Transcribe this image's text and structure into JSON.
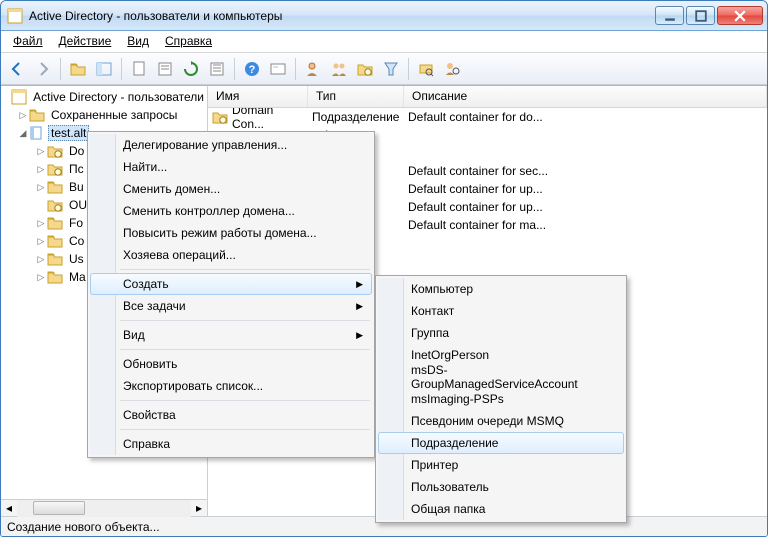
{
  "titlebar": {
    "title": "Active Directory - пользователи и компьютеры"
  },
  "menubar": {
    "file": "Файл",
    "action": "Действие",
    "view": "Вид",
    "help": "Справка"
  },
  "tree": {
    "root": "Active Directory - пользователи",
    "saved": "Сохраненные запросы",
    "domain": "test.alt",
    "children": [
      "Do",
      "Пс",
      "Bu",
      "OU",
      "Fo",
      "Co",
      "Us",
      "Ma"
    ]
  },
  "columns": {
    "name": "Имя",
    "type": "Тип",
    "desc": "Описание"
  },
  "rows": [
    {
      "name": "Domain Con...",
      "type": "Подразделение",
      "desc": "Default container for do..."
    },
    {
      "name": "",
      "type": "nain",
      "desc": ""
    },
    {
      "name": "",
      "type": "ение",
      "desc": ""
    },
    {
      "name": "",
      "type": "",
      "desc": "Default container for sec..."
    },
    {
      "name": "",
      "type": "",
      "desc": "Default container for up..."
    },
    {
      "name": "",
      "type": "",
      "desc": "Default container for up..."
    },
    {
      "name": "",
      "type": "",
      "desc": "Default container for ma..."
    }
  ],
  "ctx1": {
    "delegate": "Делегирование управления...",
    "find": "Найти...",
    "change_domain": "Сменить домен...",
    "change_dc": "Сменить контроллер домена...",
    "raise": "Повысить режим работы домена...",
    "masters": "Хозяева операций...",
    "create": "Создать",
    "all_tasks": "Все задачи",
    "view": "Вид",
    "refresh": "Обновить",
    "export": "Экспортировать список...",
    "properties": "Свойства",
    "help": "Справка"
  },
  "ctx2": {
    "items": [
      "Компьютер",
      "Контакт",
      "Группа",
      "InetOrgPerson",
      "msDS-GroupManagedServiceAccount",
      "msImaging-PSPs",
      "Псевдоним очереди MSMQ",
      "Подразделение",
      "Принтер",
      "Пользователь",
      "Общая папка"
    ],
    "hovered_index": 7
  },
  "status": "Создание нового объекта..."
}
